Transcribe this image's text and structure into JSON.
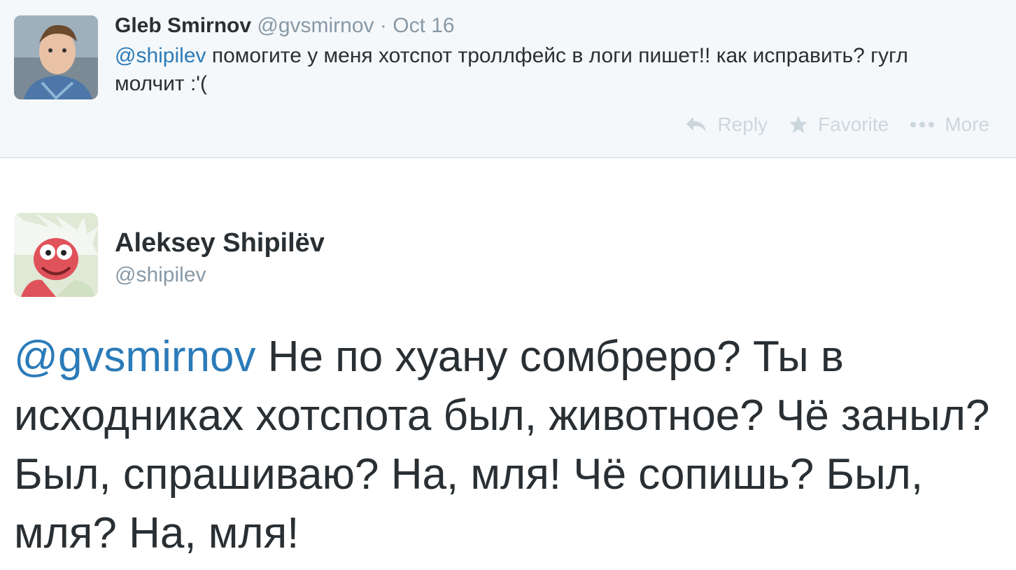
{
  "parent_tweet": {
    "fullname": "Gleb Smirnov",
    "screen_name": "@gvsmirnov",
    "separator": "·",
    "date": "Oct 16",
    "mention": "@shipilev",
    "text": "помогите у меня хотспот троллфейс в логи пишет!! как исправить? гугл молчит :'(",
    "actions": {
      "reply": "Reply",
      "favorite": "Favorite",
      "more": "More"
    }
  },
  "main_tweet": {
    "fullname": "Aleksey Shipilëv",
    "screen_name": "@shipilev",
    "mention": "@gvsmirnov",
    "text": "Не по хуану сомбреро? Ты в исходниках хотспота был, животное? Чё заныл? Был, спрашиваю? На, мля! Чё сопишь? Был, мля? На, мля!"
  },
  "colors": {
    "link": "#2b7bb9",
    "text": "#292f33",
    "muted": "#8899a6",
    "action": "#ccd6dd",
    "parent_bg": "#f5f8fa"
  }
}
